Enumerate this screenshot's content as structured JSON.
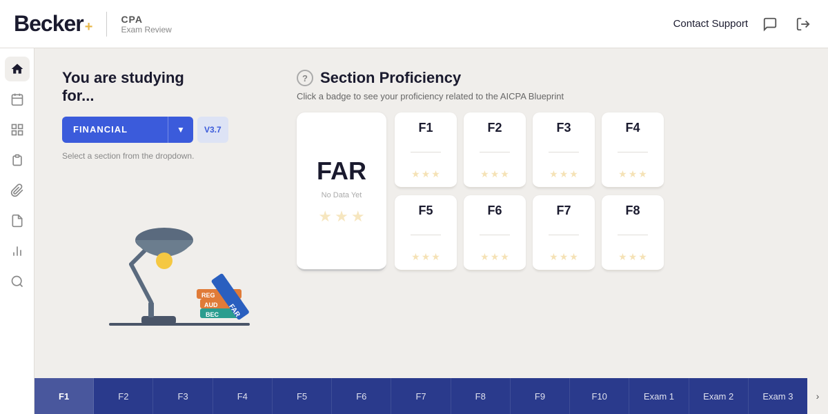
{
  "header": {
    "logo_text": "Becker",
    "logo_plus": "+",
    "cpa_label": "CPA",
    "exam_review": "Exam Review",
    "contact_support": "Contact Support"
  },
  "sidebar": {
    "items": [
      {
        "icon": "🏠",
        "name": "home",
        "active": true
      },
      {
        "icon": "📅",
        "name": "calendar",
        "active": false
      },
      {
        "icon": "⊞",
        "name": "grid",
        "active": false
      },
      {
        "icon": "📋",
        "name": "clipboard",
        "active": false
      },
      {
        "icon": "📎",
        "name": "attach",
        "active": false
      },
      {
        "icon": "📄",
        "name": "document",
        "active": false
      },
      {
        "icon": "📊",
        "name": "chart",
        "active": false
      },
      {
        "icon": "🔍",
        "name": "search",
        "active": false
      }
    ]
  },
  "study_section": {
    "title_line1": "You are studying",
    "title_line2": "for...",
    "dropdown_label": "FINANCIAL",
    "version": "V3.7",
    "select_hint": "Select a section from the dropdown."
  },
  "proficiency": {
    "help_icon": "?",
    "title": "Section Proficiency",
    "subtitle": "Click a badge to see your proficiency related to the AICPA Blueprint",
    "far_label": "FAR",
    "far_no_data": "No Data Yet",
    "badges": [
      {
        "label": "F1",
        "stars": [
          0,
          0,
          0
        ]
      },
      {
        "label": "F2",
        "stars": [
          0,
          0,
          0
        ]
      },
      {
        "label": "F3",
        "stars": [
          0,
          0,
          0
        ]
      },
      {
        "label": "F4",
        "stars": [
          0,
          0,
          0
        ]
      },
      {
        "label": "F5",
        "stars": [
          0,
          0,
          0
        ]
      },
      {
        "label": "F6",
        "stars": [
          0,
          0,
          0
        ]
      },
      {
        "label": "F7",
        "stars": [
          0,
          0,
          0
        ]
      },
      {
        "label": "F8",
        "stars": [
          0,
          0,
          0
        ]
      }
    ]
  },
  "bottom_tabs": {
    "tabs": [
      "F1",
      "F2",
      "F3",
      "F4",
      "F5",
      "F6",
      "F7",
      "F8",
      "F9",
      "F10",
      "Exam 1",
      "Exam 2",
      "Exam 3"
    ],
    "expand_icon": "›"
  }
}
